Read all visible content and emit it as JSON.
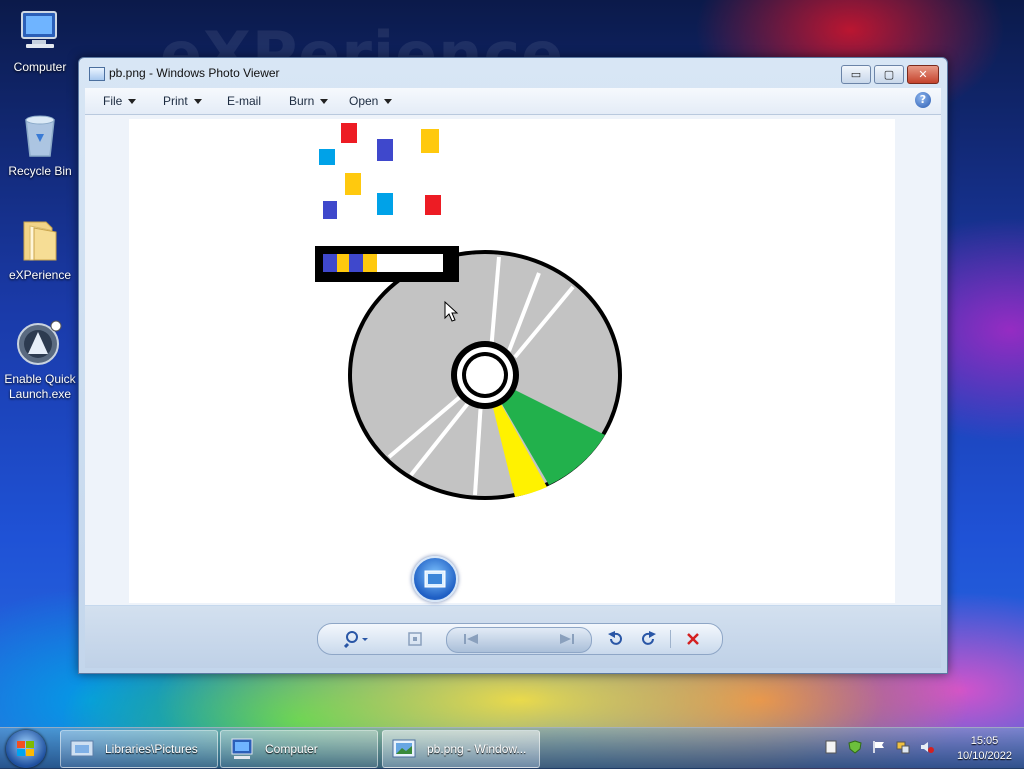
{
  "desktop": {
    "wallpaper_text": "eXPerience",
    "icons": [
      {
        "label": "Computer"
      },
      {
        "label": "Recycle Bin"
      },
      {
        "label": "eXPerience"
      },
      {
        "label": "Enable Quick Launch.exe"
      }
    ]
  },
  "window": {
    "title": "pb.png - Windows Photo Viewer",
    "buttons": {
      "minimize": "▭",
      "maximize": "▢",
      "close": "✕"
    },
    "menu": [
      {
        "label": "File",
        "has_dropdown": true
      },
      {
        "label": "Print",
        "has_dropdown": true
      },
      {
        "label": "E-mail",
        "has_dropdown": false
      },
      {
        "label": "Burn",
        "has_dropdown": true
      },
      {
        "label": "Open",
        "has_dropdown": true
      }
    ],
    "help_label": "?",
    "image_colors": {
      "disc": "#c3c3c3",
      "green_sector": "#22b14c",
      "yellow_sector": "#fff200",
      "red": "#ed1c24",
      "blue": "#3f48cc",
      "cyan": "#00a2e8",
      "gold": "#ffc90e"
    },
    "controls": [
      "zoom-icon",
      "fit-icon",
      "previous-icon",
      "slideshow-icon",
      "next-icon",
      "rotate-left-icon",
      "rotate-right-icon",
      "delete-icon"
    ]
  },
  "taskbar": {
    "tasks": [
      {
        "label": "Libraries\\Pictures"
      },
      {
        "label": "Computer"
      },
      {
        "label": "pb.png - Window..."
      }
    ],
    "clock_time": "15:05",
    "clock_date": "10/10/2022"
  }
}
